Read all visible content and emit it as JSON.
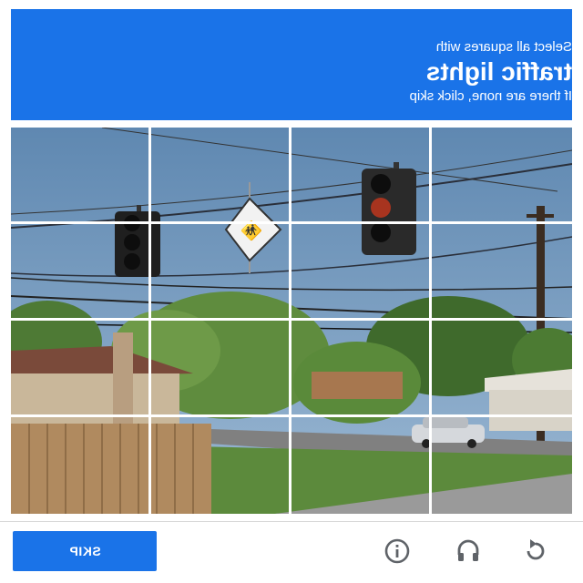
{
  "header": {
    "instruction": "Select all squares with",
    "target": "traffic lights",
    "hint": "If there are none, click skip",
    "color": "#1a73e8"
  },
  "grid": {
    "rows": 4,
    "cols": 4
  },
  "footer": {
    "skip_label": "SKIP",
    "icons": [
      "reload-icon",
      "audio-icon",
      "info-icon"
    ]
  },
  "colors": {
    "accent": "#1a73e8",
    "icon": "#5f6368"
  }
}
